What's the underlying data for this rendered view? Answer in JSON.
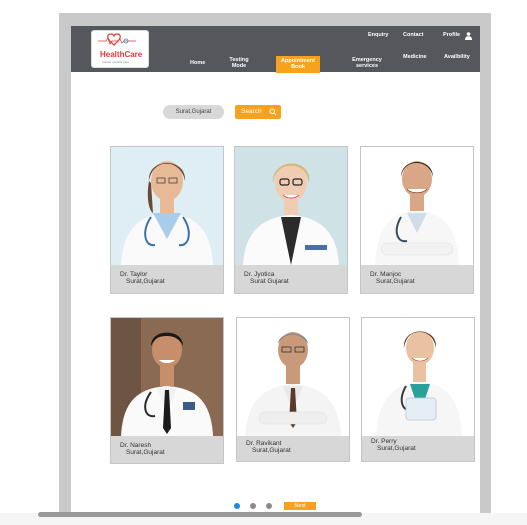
{
  "brand": {
    "name": "HealthCare",
    "tagline": "trusted medical care"
  },
  "top_links": {
    "enquiry": "Enquiry",
    "contact": "Contact",
    "profile": "Profile"
  },
  "nav": {
    "home": "Home",
    "testing_mode": "Testing Mode",
    "appointment_book": "Appointment Book",
    "emergency_services": "Emergency services",
    "medicine": "Medicine",
    "availability": "Availbility"
  },
  "search": {
    "value": "Surat,Gujarat",
    "button": "Search"
  },
  "doctors": [
    {
      "name": "Dr. Taylor",
      "location": "Surat,Gujarat"
    },
    {
      "name": "Dr. Jyotica",
      "location": "Surat Gujarat"
    },
    {
      "name": "Dr. Manjoc",
      "location": "Surat,Gujarat"
    },
    {
      "name": "Dr. Naresh",
      "location": "Surat,Gujarat"
    },
    {
      "name": "Dr. Ravikant",
      "location": "Surat,Gujarat"
    },
    {
      "name": "Dr. Perry",
      "location": "Surat,Gujarat"
    }
  ],
  "pagination": {
    "next": "Next",
    "active_page": 1,
    "pages": 3
  },
  "colors": {
    "accent": "#f6a21e",
    "navbar": "#55575d",
    "dot_active": "#1e88e5",
    "dot_inactive": "#8a8a8a"
  }
}
